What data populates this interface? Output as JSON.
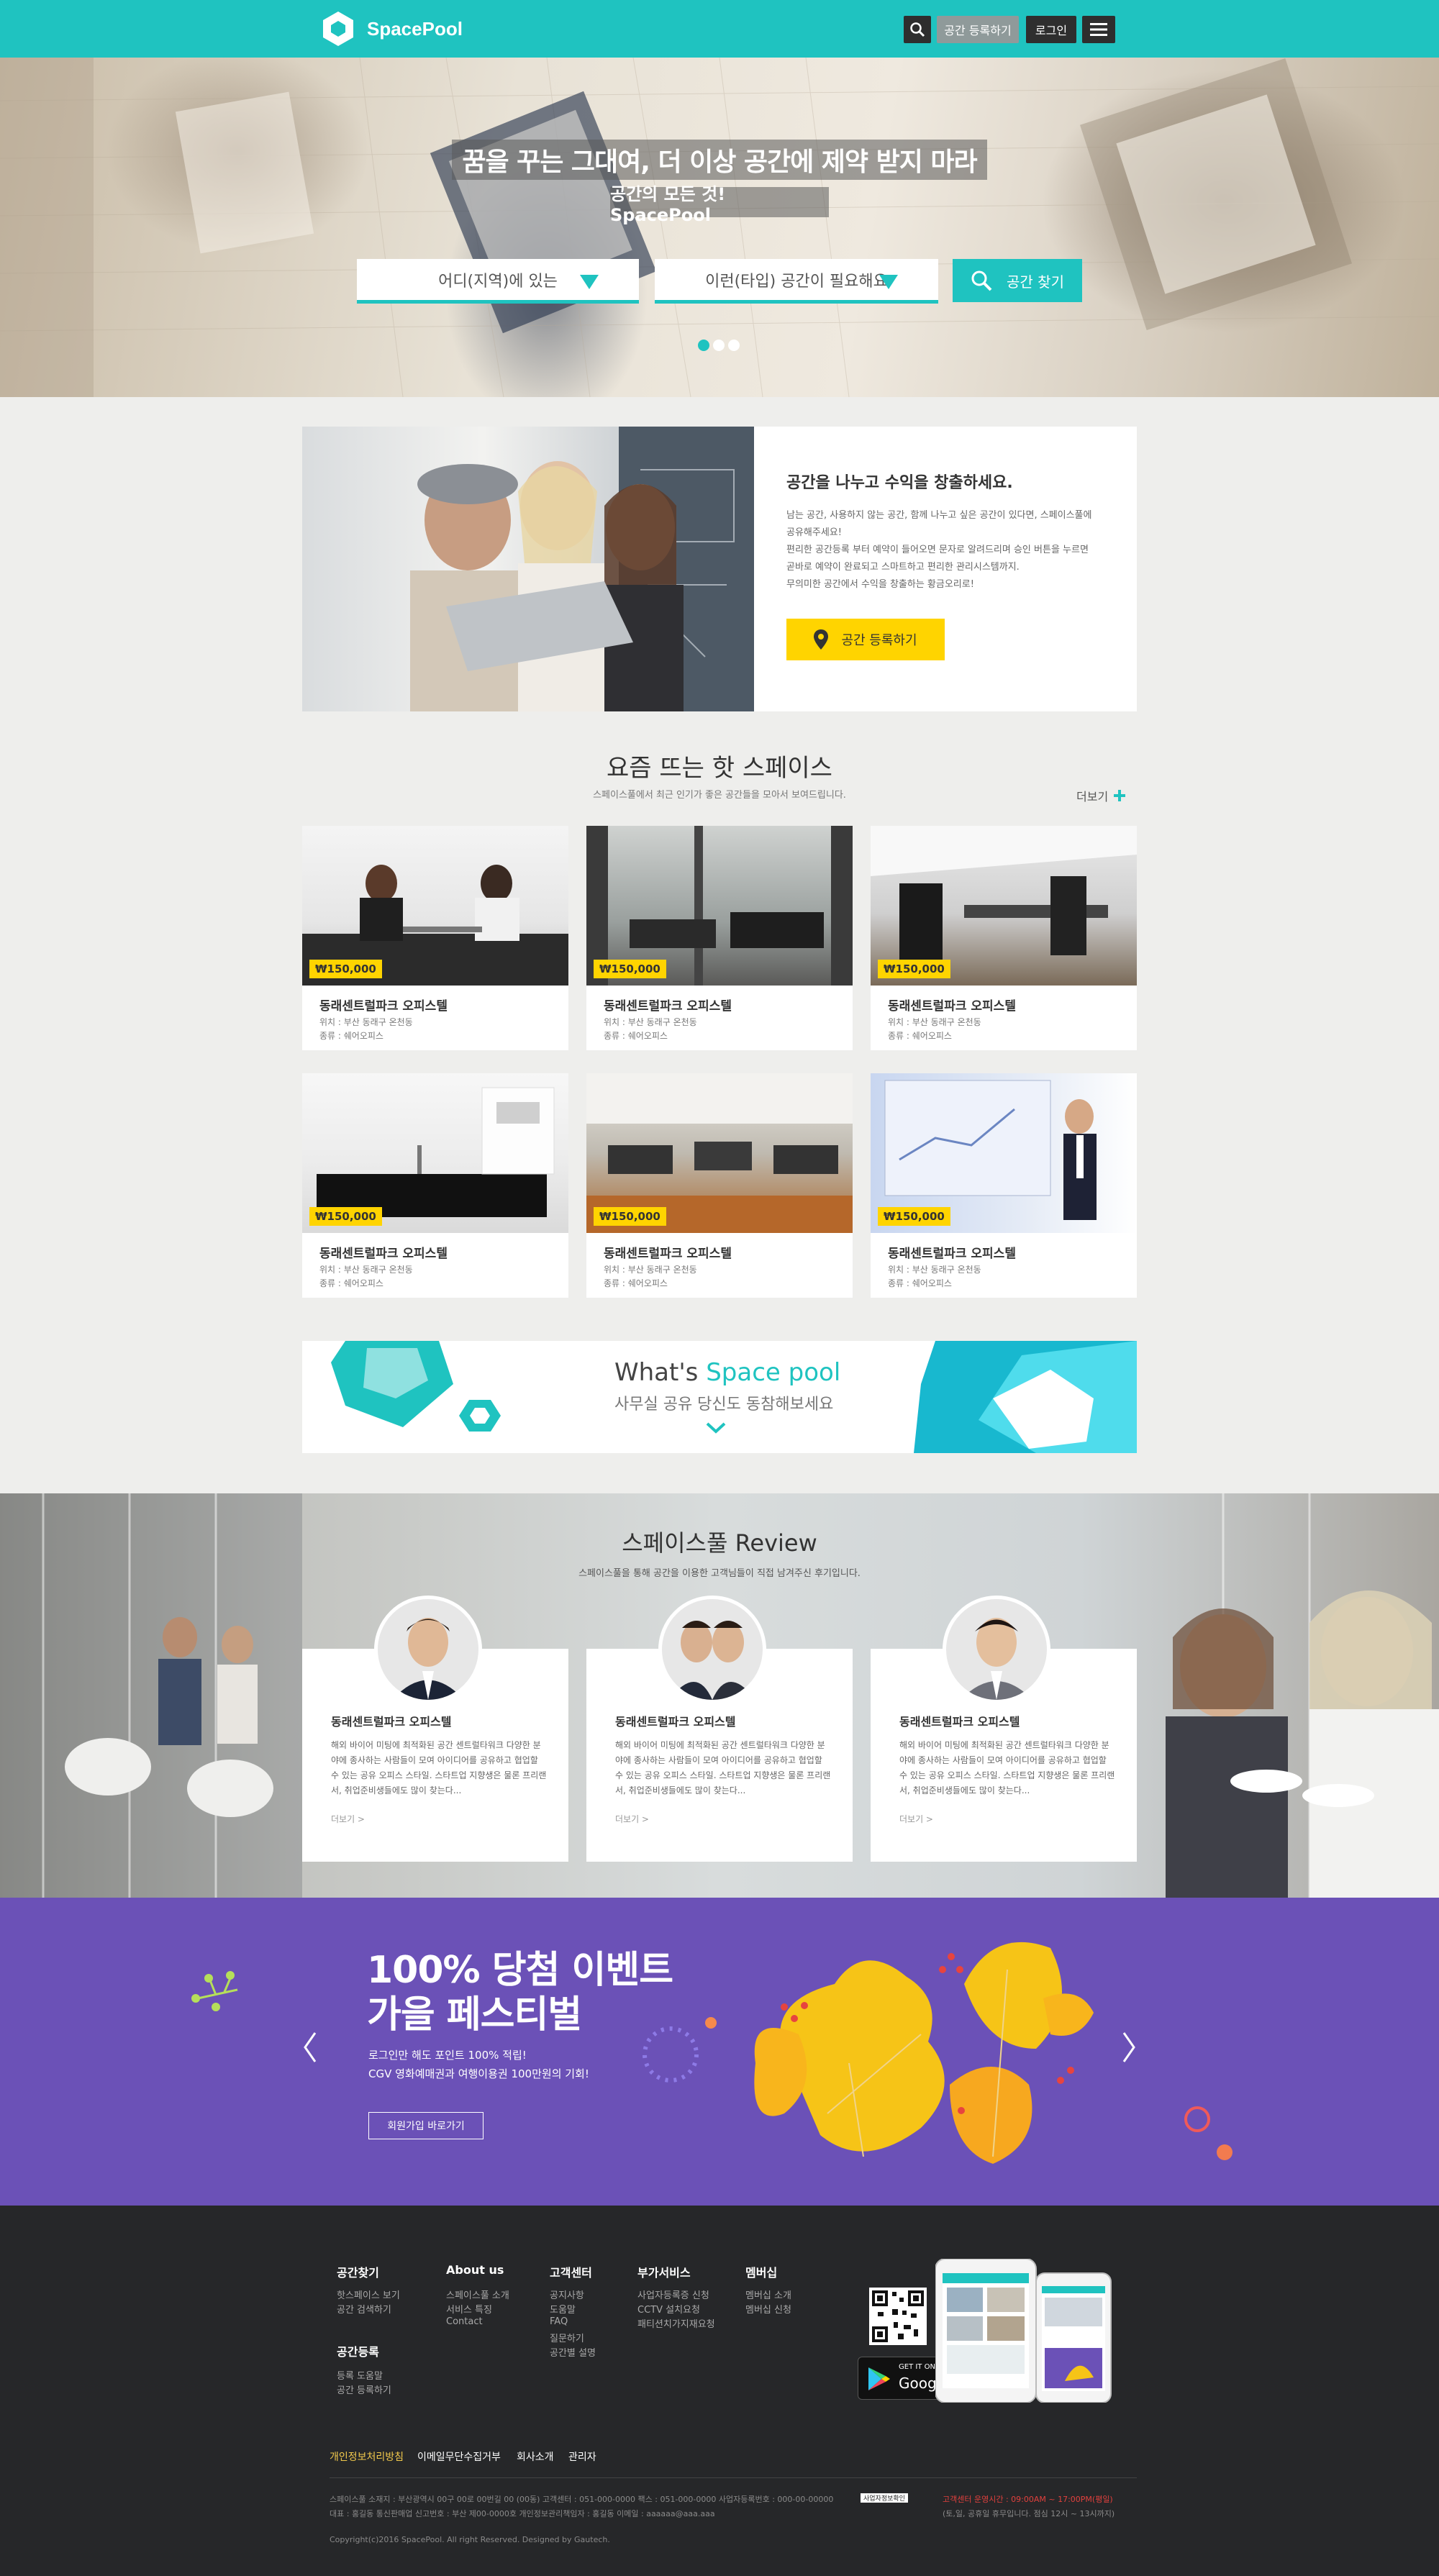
{
  "header": {
    "brand": "SpacePool",
    "register_label": "공간 등록하기",
    "login_label": "로그인",
    "brand_color": "#1fc3c0"
  },
  "hero": {
    "title": "꿈을 꾸는 그대여, 더 이상 공간에 제약 받지 마라",
    "subtitle": "공간의 모든 것! SpacePool",
    "region_select": "어디(지역)에 있는",
    "type_select": "이런(타입) 공간이 필요해요",
    "search_label": "공간 찾기",
    "slides": 3,
    "active_slide": 1
  },
  "register": {
    "heading": "공간을 나누고 수익을 창출하세요.",
    "lines": [
      "남는 공간, 사용하지 않는 공간, 함께 나누고 싶은 공간이 있다면, 스페이스풀에",
      "공유해주세요!",
      "편리한 공간등록 부터 예약이 들어오면 문자로 알려드리며 승인 버튼을 누르면",
      "곧바로 예약이 완료되고 스마트하고 편리한 관리시스템까지.",
      "무의미한 공간에서 수익을 창출하는 황금오리로!"
    ],
    "button_label": "공간 등록하기"
  },
  "hot": {
    "title": "요즘 뜨는 핫 스페이스",
    "subtitle": "스페이스풀에서 최근 인기가 좋은 공간들을 모아서 보여드립니다.",
    "more_label": "더보기",
    "cards": [
      {
        "price": "₩150,000",
        "name": "동래센트럴파크 오피스텔",
        "location": "위치 : 부산 동래구 온천동",
        "type": "종류 : 쉐어오피스"
      },
      {
        "price": "₩150,000",
        "name": "동래센트럴파크 오피스텔",
        "location": "위치 : 부산 동래구 온천동",
        "type": "종류 : 쉐어오피스"
      },
      {
        "price": "₩150,000",
        "name": "동래센트럴파크 오피스텔",
        "location": "위치 : 부산 동래구 온천동",
        "type": "종류 : 쉐어오피스"
      },
      {
        "price": "₩150,000",
        "name": "동래센트럴파크 오피스텔",
        "location": "위치 : 부산 동래구 온천동",
        "type": "종류 : 쉐어오피스"
      },
      {
        "price": "₩150,000",
        "name": "동래센트럴파크 오피스텔",
        "location": "위치 : 부산 동래구 온천동",
        "type": "종류 : 쉐어오피스"
      },
      {
        "price": "₩150,000",
        "name": "동래센트럴파크 오피스텔",
        "location": "위치 : 부산 동래구 온천동",
        "type": "종류 : 쉐어오피스"
      }
    ]
  },
  "whats": {
    "title_plain": "What's",
    "title_accent": "Space pool",
    "subtitle": "사무실 공유 당신도 동참해보세요"
  },
  "review": {
    "title": "스페이스풀 Review",
    "subtitle": "스페이스풀을 통해 공간을 이용한 고객님들이 직접 남겨주신 후기입니다.",
    "cards": [
      {
        "name": "동래센트럴파크 오피스텔",
        "text": "해외 바이어 미팅에 최적화된 공간 센트럴타워크 다양한 분야에 종사하는 사람들이 모여 아이디어를 공유하고 협업할 수 있는 공유 오피스 스타일. 스타트업 지향생은 물론 프리랜서, 취업준비생들에도 많이 찾는다...",
        "more": "더보기 >"
      },
      {
        "name": "동래센트럴파크 오피스텔",
        "text": "해외 바이어 미팅에 최적화된 공간 센트럴타워크 다양한 분야에 종사하는 사람들이 모여 아이디어를 공유하고 협업할 수 있는 공유 오피스 스타일. 스타트업 지향생은 물론 프리랜서, 취업준비생들에도 많이 찾는다...",
        "more": "더보기 >"
      },
      {
        "name": "동래센트럴파크 오피스텔",
        "text": "해외 바이어 미팅에 최적화된 공간 센트럴타워크 다양한 분야에 종사하는 사람들이 모여 아이디어를 공유하고 협업할 수 있는 공유 오피스 스타일. 스타트업 지향생은 물론 프리랜서, 취업준비생들에도 많이 찾는다...",
        "more": "더보기 >"
      }
    ]
  },
  "event": {
    "title_line1": "100% 당첨 이벤트",
    "title_line2": "가을 페스티벌",
    "desc_line1": "로그인만 해도 포인트 100% 적립!",
    "desc_line2": "CGV 영화예매권과 여행이용권 100만원의 기회!",
    "button_label": "회원가입 바로가기",
    "bg_color": "#6b51b7"
  },
  "footer": {
    "columns": [
      {
        "heading": "공간찾기",
        "links": [
          "핫스페이스 보기",
          "공간 검색하기"
        ]
      },
      {
        "heading": "공간등록",
        "links": [
          "등록 도움말",
          "공간 등록하기"
        ]
      },
      {
        "heading": "About us",
        "links": [
          "스페이스풀 소개",
          "서비스 특징",
          "Contact"
        ]
      },
      {
        "heading": "고객센터",
        "links": [
          "공지사항",
          "도움말",
          "FAQ",
          "질문하기",
          "공간별 설명"
        ]
      },
      {
        "heading": "부가서비스",
        "links": [
          "사업자등록증 신청",
          "CCTV 설치요청",
          "패티션치가지재요청"
        ]
      },
      {
        "heading": "멤버십",
        "links": [
          "멤버십 소개",
          "멤버십 신청"
        ]
      }
    ],
    "store_get": "GET IT ON",
    "store_name": "Google play",
    "nav": [
      "개인정보처리방침",
      "이메일무단수집거부",
      "회사소개",
      "관리자"
    ],
    "info_line1": "스페이스풀    소재지 : 부산광역시 00구 00로 00번길 00 (00동)    고객센터 : 051-000-0000    팩스 : 051-000-0000    사업자등록번호 : 000-00-00000",
    "info_line2": "대표 : 홍길동    통신판매업 신고번호 : 부산 제00-0000호    개인정보관리책임자 : 홍길동    이메일 : aaaaaa@aaa.aaa",
    "copyright": "Copyright(c)2016 SpacePool. All right Reserved. Designed by Gautech.",
    "cs_line1": "고객센터 운영시간 : 09:00AM ~ 17:00PM(평일)",
    "cs_line2": "(토,일, 공휴일 휴무입니다. 점심 12시 ~ 13시까지)",
    "biz_badge": "사업자정보확인"
  }
}
